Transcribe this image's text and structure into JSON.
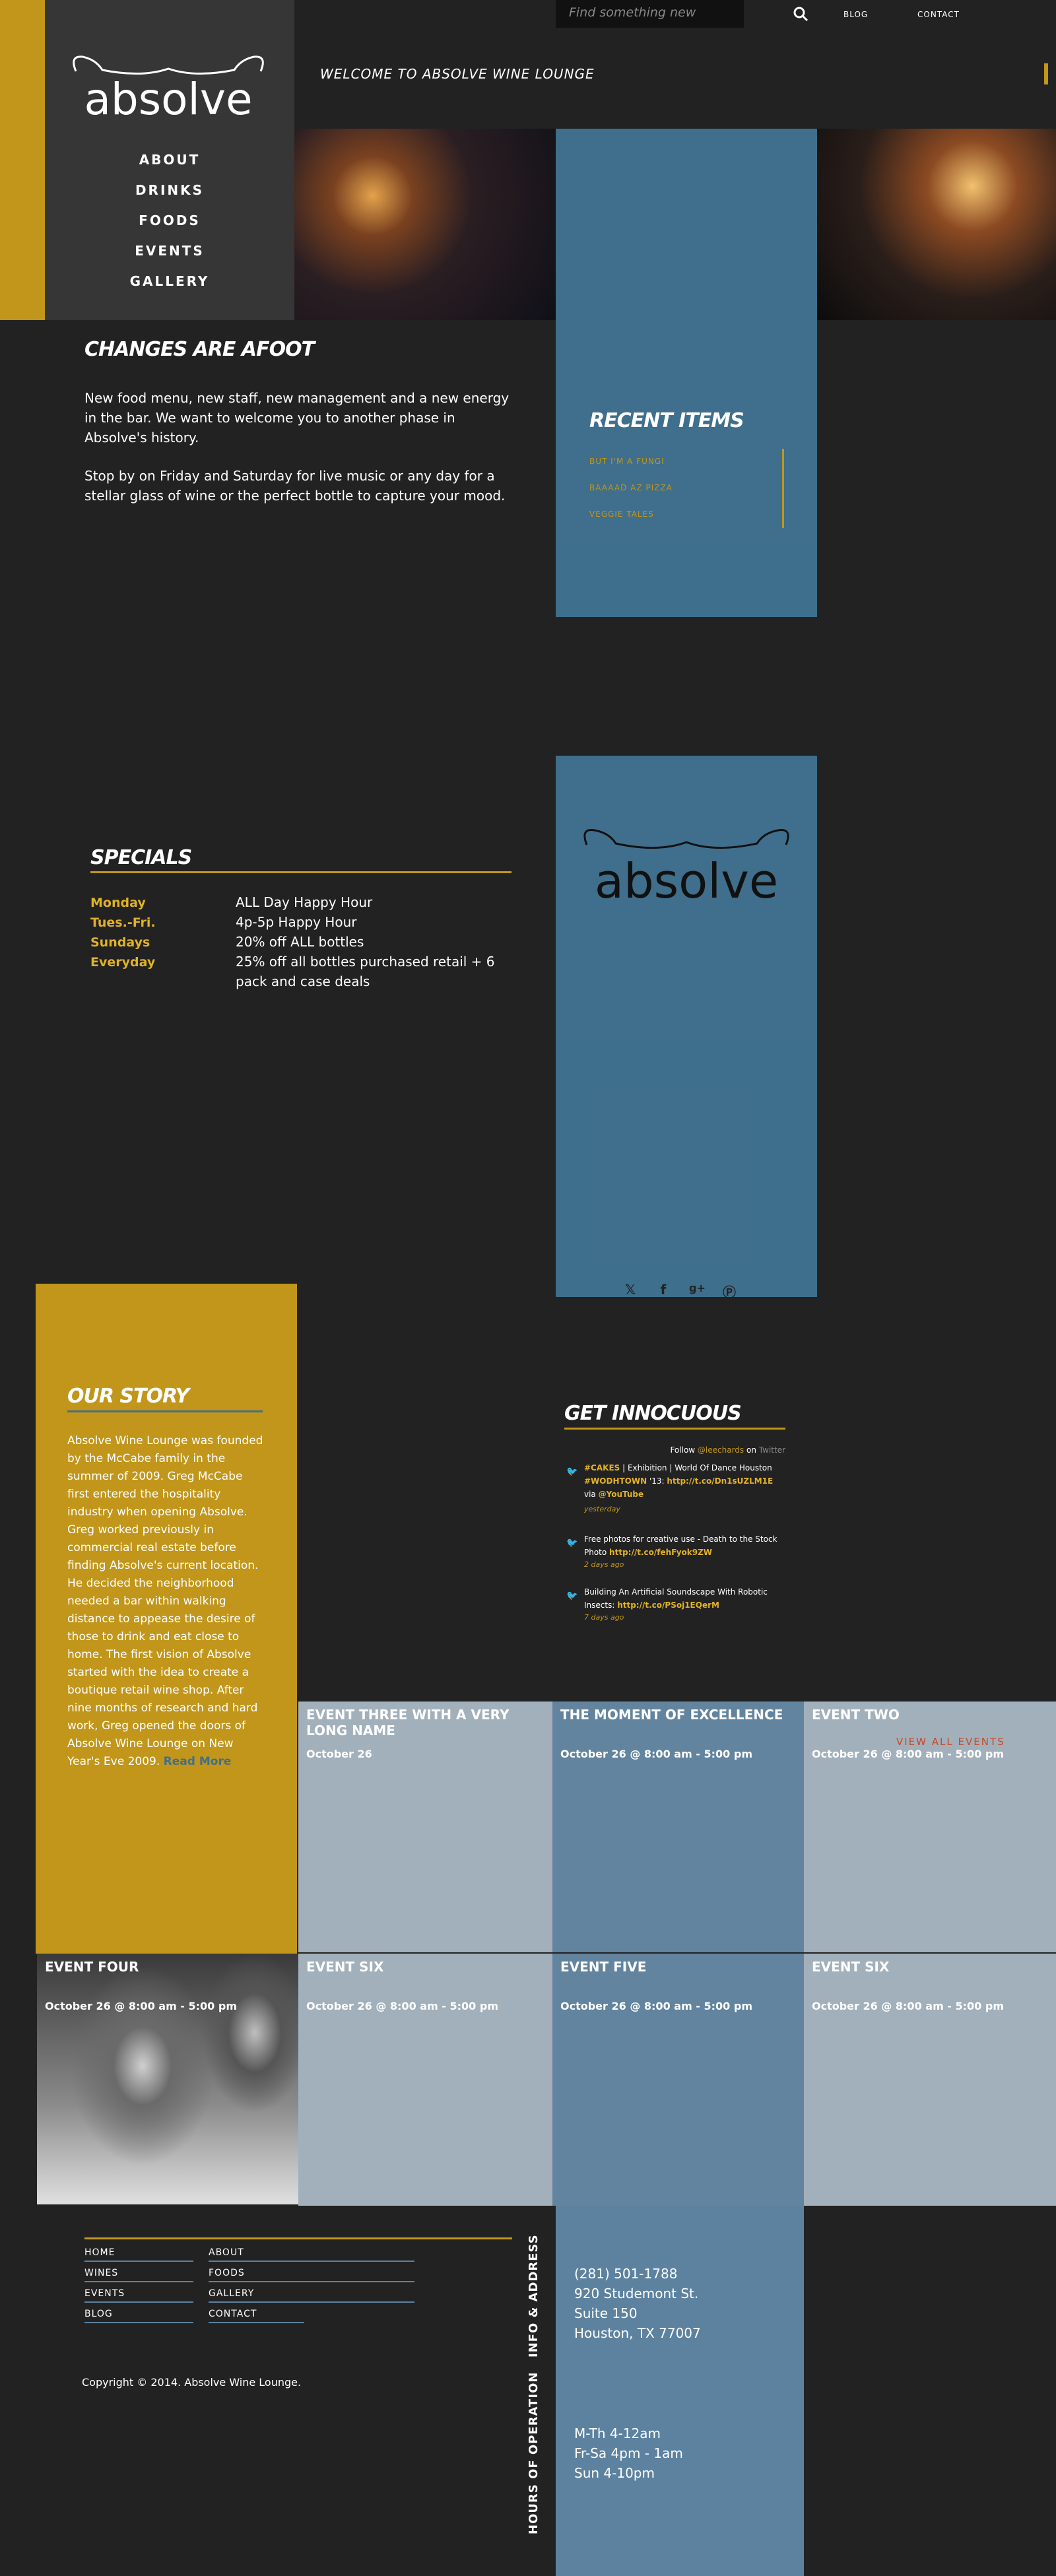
{
  "brand": {
    "logo_text": "absolve"
  },
  "topbar": {
    "search_placeholder": "Find something new",
    "links": [
      "BLOG",
      "CONTACT"
    ]
  },
  "nav": [
    "ABOUT",
    "DRINKS",
    "FOODS",
    "EVENTS",
    "GALLERY"
  ],
  "welcome": "WELCOME TO ABSOLVE WINE LOUNGE",
  "changes": {
    "title": "CHANGES ARE AFOOT",
    "p1": "New food menu, new staff, new management and a new energy in the bar. We want to welcome you to another phase in Absolve's history.",
    "p2": "Stop by on Friday and Saturday for live music or any day for a stellar glass of wine or the perfect bottle to capture your mood."
  },
  "recent": {
    "title": "RECENT ITEMS",
    "items": [
      "BUT I'M A FUNGI",
      "BAAAAD AZ PIZZA",
      "VEGGIE TALES"
    ]
  },
  "specials": {
    "title": "SPECIALS",
    "rows": [
      {
        "day": "Monday",
        "deal": "ALL Day Happy Hour"
      },
      {
        "day": "Tues.-Fri.",
        "deal": "4p-5p Happy Hour"
      },
      {
        "day": "Sundays",
        "deal": "20% off ALL bottles"
      },
      {
        "day": "Everyday",
        "deal": "25% off all bottles purchased retail + 6 pack and case deals"
      }
    ]
  },
  "social": [
    "twitter-icon",
    "facebook-icon",
    "google-plus-icon",
    "pinterest-icon"
  ],
  "story": {
    "title": "OUR STORY",
    "text": "Absolve Wine Lounge was founded by the McCabe family in the summer of 2009. Greg McCabe first entered the hospitality industry when opening Absolve. Greg worked previously in commercial real estate before finding Absolve's current location. He decided the neighborhood needed a bar within walking distance to appease the desire of those to drink and eat close to home. The first vision of Absolve started with the idea to create a boutique retail wine shop. After nine months of research and hard work, Greg opened the doors of Absolve Wine Lounge on New Year's Eve 2009.",
    "more": "Read More"
  },
  "twitter": {
    "title": "GET INNOCUOUS",
    "follow_prefix": "Follow",
    "follow_handle": "@leechards",
    "follow_mid": "on",
    "follow_site": "Twitter",
    "tweets": [
      {
        "text_a": "#CAKES",
        "text_b": " | Exhibition | World Of Dance Houston ",
        "text_c": "#WODHTOWN",
        "text_d": " '13: ",
        "text_e": "http://t.co/Dn1sUZLM1E",
        "text_f": " via ",
        "text_g": "@YouTube",
        "time": "yesterday"
      },
      {
        "text_a": "Free photos for creative use - Death to the Stock Photo ",
        "text_b": "http://t.co/fehFyok9ZW",
        "time": "2 days ago"
      },
      {
        "text_a": "Building An Artificial Soundscape With Robotic Insects: ",
        "text_b": "http://t.co/PSoj1EQerM",
        "time": "7 days ago"
      }
    ]
  },
  "events": {
    "view_all": "VIEW ALL EVENTS",
    "row1": [
      {
        "title": "EVENT THREE WITH A VERY LONG NAME",
        "date": "October 26"
      },
      {
        "title": "THE MOMENT OF EXCELLENCE",
        "date": "October 26 @ 8:00 am - 5:00 pm"
      },
      {
        "title": "EVENT TWO",
        "date": "October 26 @ 8:00 am - 5:00 pm"
      }
    ],
    "row2": [
      {
        "title": "EVENT FOUR",
        "date": "October 26 @ 8:00 am - 5:00 pm"
      },
      {
        "title": "EVENT SIX",
        "date": "October 26 @ 8:00 am - 5:00 pm"
      },
      {
        "title": "EVENT FIVE",
        "date": "October 26 @ 8:00 am - 5:00 pm"
      },
      {
        "title": "EVENT SIX",
        "date": "October 26 @ 8:00 am - 5:00 pm"
      }
    ]
  },
  "footer": {
    "col1": [
      "HOME",
      "WINES",
      "EVENTS",
      "BLOG"
    ],
    "col2": [
      "ABOUT",
      "FOODS",
      "GALLERY",
      "CONTACT"
    ],
    "copyright": "Copyright © 2014. Absolve Wine Lounge.",
    "info_label": "INFO & ADDRESS",
    "hours_label": "HOURS OF OPERATION",
    "address": [
      "(281) 501-1788",
      "920 Studemont St.",
      "Suite 150",
      "Houston, TX 77007"
    ],
    "hours": [
      "M-Th 4-12am",
      "Fr-Sa 4pm - 1am",
      "Sun 4-10pm"
    ]
  }
}
